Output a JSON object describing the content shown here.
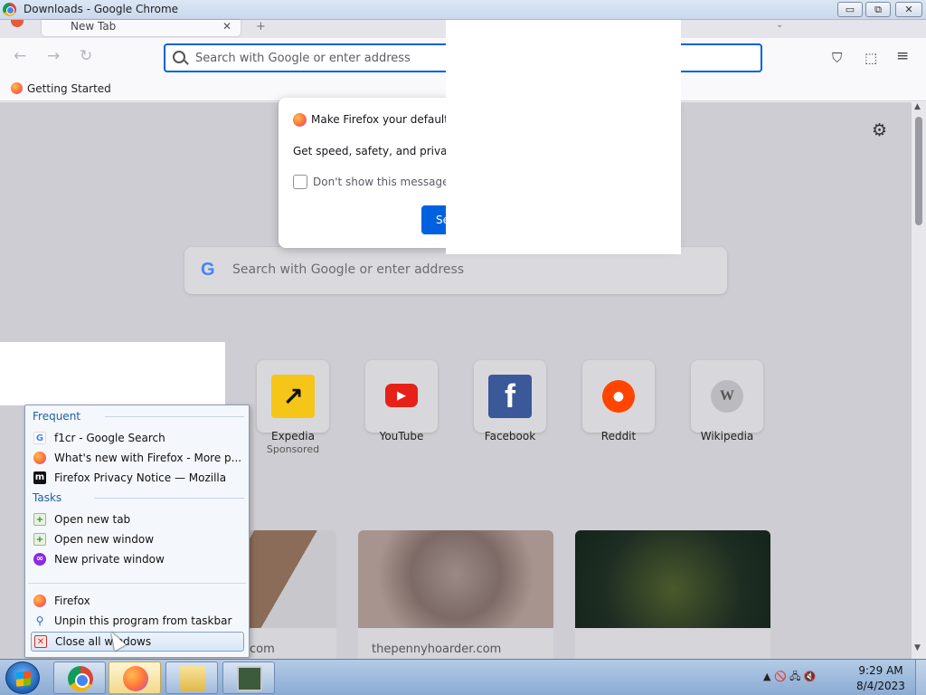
{
  "window": {
    "title": "Downloads - Google Chrome",
    "controls": {
      "minimize": "▭",
      "maximize": "⧉",
      "close": "✕"
    }
  },
  "tabs": [
    {
      "label": "New Tab",
      "close": "✕"
    }
  ],
  "tabstrip": {
    "new_tab": "+",
    "list_all": "⌄"
  },
  "toolbar": {
    "back": "←",
    "forward": "→",
    "reload": "↻",
    "urlbar_placeholder": "Search with Google or enter address",
    "icons": [
      "pocket-icon",
      "extensions-icon",
      "menu-icon"
    ],
    "pocket": "⛉",
    "extensions": "⬚",
    "menu": "≡"
  },
  "bookmarks": [
    {
      "label": "Getting Started"
    }
  ],
  "newtab": {
    "settings": "⚙",
    "search": {
      "logo": "G",
      "placeholder": "Search with Google or enter address"
    },
    "shortcuts": [
      {
        "label": "Expedia",
        "sublabel": "Sponsored",
        "glyph": "↗",
        "color": "#f5c518"
      },
      {
        "label": "YouTube",
        "glyph": "▶",
        "color": "#e62117"
      },
      {
        "label": "Facebook",
        "glyph": "f",
        "color": "#3b5998"
      },
      {
        "label": "Reddit",
        "glyph": "●",
        "color": "#ff4500"
      },
      {
        "label": "Wikipedia",
        "glyph": "W",
        "color": "#aaaaaa"
      }
    ],
    "stories": [
      {
        "source": "com"
      },
      {
        "source": "thepennyhoarder.com"
      },
      {
        "source": ""
      }
    ]
  },
  "default_dialog": {
    "title": "Make Firefox your default br",
    "body": "Get speed, safety, and privacy ev",
    "checkbox_label": "Don't show this message ag",
    "primary_button": "Se"
  },
  "jumplist": {
    "frequent_header": "Frequent",
    "frequent": [
      {
        "label": "f1cr - Google Search",
        "icon": "google-icon"
      },
      {
        "label": "What's new with Firefox - More p...",
        "icon": "firefox-icon"
      },
      {
        "label": "Firefox Privacy Notice — Mozilla",
        "icon": "mozilla-icon"
      }
    ],
    "tasks_header": "Tasks",
    "tasks": [
      {
        "label": "Open new tab",
        "icon": "new-tab-icon"
      },
      {
        "label": "Open new window",
        "icon": "new-window-icon"
      },
      {
        "label": "New private window",
        "icon": "private-window-icon"
      }
    ],
    "app_items": [
      {
        "label": "Firefox",
        "icon": "firefox-icon"
      },
      {
        "label": "Unpin this program from taskbar",
        "icon": "unpin-icon"
      },
      {
        "label": "Close all windows",
        "icon": "close-window-icon"
      }
    ]
  },
  "taskbar": {
    "pinned": [
      "chrome",
      "firefox",
      "explorer",
      "task-manager"
    ],
    "tray": "▲ 🚫 🖧 🔇",
    "time": "9:29 AM",
    "date": "8/4/2023"
  }
}
